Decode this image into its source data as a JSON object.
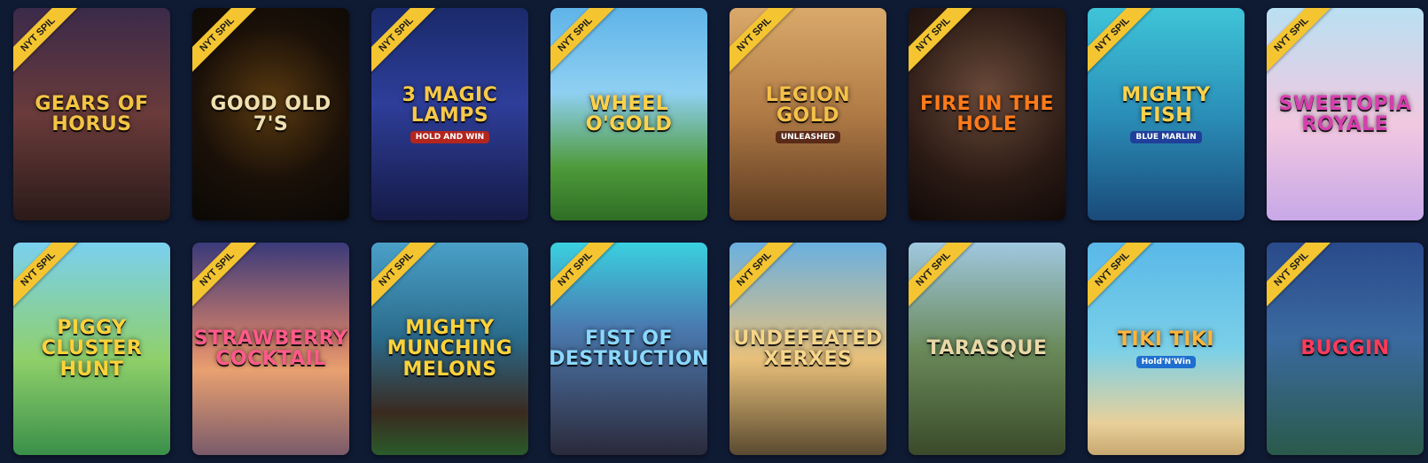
{
  "badge_label": "NYT SPIL",
  "games": [
    {
      "title": "Gears of Horus",
      "sub": "",
      "bg": "linear-gradient(180deg,#3b2a4a 0%,#6a3b3a 50%,#2a1a18 100%)",
      "fg": "#f2c443",
      "subbg": "#2e5d8a"
    },
    {
      "title": "Good Old 7's",
      "sub": "",
      "bg": "radial-gradient(circle at 50% 45%,#5a3a10 0%,#1a1008 55%,#0a0805 100%)",
      "fg": "#f0e0b0",
      "subbg": "#000000"
    },
    {
      "title": "3 Magic Lamps",
      "sub": "HOLD AND WIN",
      "bg": "linear-gradient(180deg,#1a2a6a 0%,#2e3e9a 45%,#151a45 100%)",
      "fg": "#f7c948",
      "subbg": "#b3261e"
    },
    {
      "title": "Wheel O'Gold",
      "sub": "",
      "bg": "linear-gradient(180deg,#5fb4e8 0%,#8fd0f2 40%,#4e9a3a 75%,#2f6e25 100%)",
      "fg": "#ffd24a",
      "subbg": "#000000"
    },
    {
      "title": "Legion Gold",
      "sub": "UNLEASHED",
      "bg": "linear-gradient(180deg,#d9a96a 0%,#b07a45 50%,#5a3a20 100%)",
      "fg": "#f5c04a",
      "subbg": "#5a2a18"
    },
    {
      "title": "Fire in the Hole",
      "sub": "",
      "bg": "radial-gradient(circle at 50% 40%,#6a4a3a 0%,#2a1a14 60%,#120a08 100%)",
      "fg": "#ff7a1a",
      "subbg": "#000000"
    },
    {
      "title": "Mighty Fish",
      "sub": "BLUE MARLIN",
      "bg": "linear-gradient(180deg,#3fc4d8 0%,#2a8fb8 50%,#1a4a7a 100%)",
      "fg": "#ffd24a",
      "subbg": "#1f3f9a"
    },
    {
      "title": "Sweetopia Royale",
      "sub": "",
      "bg": "linear-gradient(180deg,#b9e0f2 0%,#f2c8e0 55%,#c8a8e8 100%)",
      "fg": "#d83fb0",
      "subbg": "#7a3fb8"
    },
    {
      "title": "Piggy Cluster Hunt",
      "sub": "",
      "bg": "linear-gradient(180deg,#7ad0f0 0%,#8fd06a 55%,#3a8f4a 100%)",
      "fg": "#ffd23a",
      "subbg": "#000000"
    },
    {
      "title": "Strawberry Cocktail",
      "sub": "",
      "bg": "linear-gradient(180deg,#3a3a7a 0%,#c87a6a 45%,#e8a070 60%,#7a5a6a 100%)",
      "fg": "#ff5a8a",
      "subbg": "#000000"
    },
    {
      "title": "Mighty Munching Melons",
      "sub": "",
      "bg": "linear-gradient(180deg,#4aa0c8 0%,#2a6a8a 45%,#3a2a20 80%,#2a5a2a 100%)",
      "fg": "#ffd23a",
      "subbg": "#000000"
    },
    {
      "title": "Fist of Destruction",
      "sub": "",
      "bg": "linear-gradient(180deg,#3ad0e0 0%,#4a7ab0 40%,#3a4a6a 75%,#2a2a3a 100%)",
      "fg": "#8ad8ff",
      "subbg": "#000000"
    },
    {
      "title": "Undefeated Xerxes",
      "sub": "",
      "bg": "linear-gradient(180deg,#6ab0e0 0%,#e8c07a 55%,#5a4a30 100%)",
      "fg": "#f5d58a",
      "subbg": "#000000"
    },
    {
      "title": "Tarasque",
      "sub": "",
      "bg": "linear-gradient(180deg,#a0c8e0 0%,#6a8a5a 50%,#3a4a2a 100%)",
      "fg": "#e8d8a8",
      "subbg": "#000000"
    },
    {
      "title": "Tiki Tiki",
      "sub": "Hold'N'Win",
      "bg": "linear-gradient(180deg,#5ab8e8 0%,#7ad0e8 50%,#e8d09a 85%,#c8a870 100%)",
      "fg": "#ffb43a",
      "subbg": "#1f6fd0"
    },
    {
      "title": "Buggin",
      "sub": "",
      "bg": "linear-gradient(180deg,#2a4a8a 0%,#3a6aa0 45%,#2a5a4a 100%)",
      "fg": "#ff3a5a",
      "subbg": "#000000"
    }
  ]
}
